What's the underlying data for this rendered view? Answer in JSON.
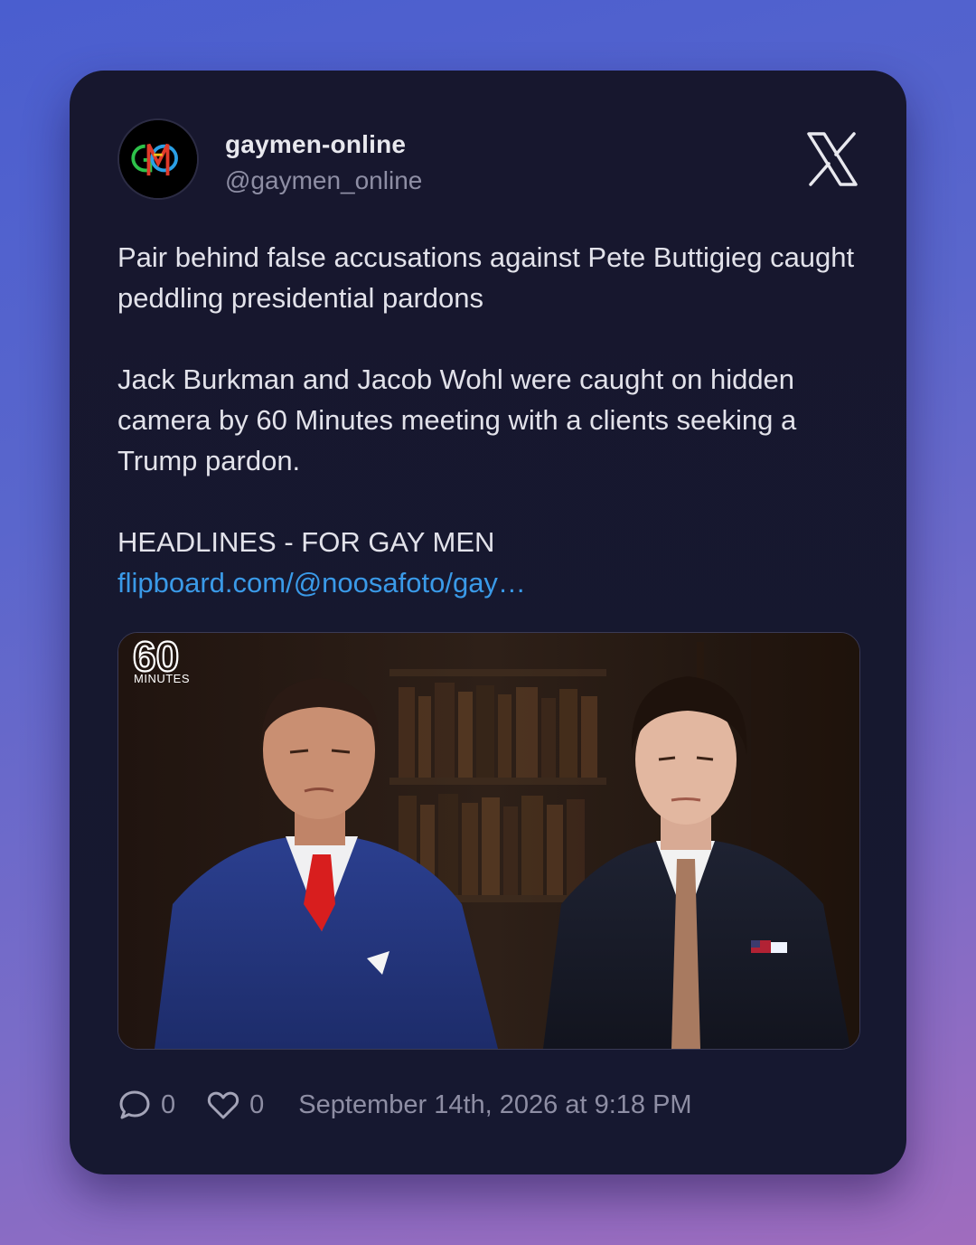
{
  "author": {
    "name": "gaymen-online",
    "handle": "@gaymen_online",
    "avatar_icon": "gmo-logo"
  },
  "platform_icon": "x-logo",
  "tweet": {
    "headline": "Pair behind false accusations against Pete Buttigieg caught peddling presidential pardons",
    "body": "Jack Burkman and Jacob Wohl were caught on hidden camera by 60 Minutes meeting with a clients seeking a Trump pardon.",
    "source_label": "HEADLINES - FOR GAY MEN",
    "link_text": "flipboard.com/@noosafoto/gay…"
  },
  "media": {
    "watermark_number": "60",
    "watermark_word": "MINUTES"
  },
  "footer": {
    "reply_count": "0",
    "like_count": "0",
    "timestamp": "September 14th, 2026 at 9:18 PM"
  },
  "colors": {
    "card_bg": "#17172e",
    "link": "#3a9ae8",
    "muted": "#8e8ea4",
    "text": "#e2e2ea"
  }
}
